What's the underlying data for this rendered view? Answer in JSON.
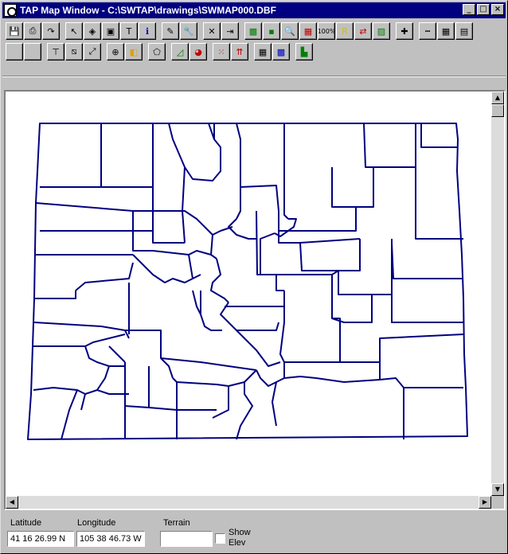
{
  "window": {
    "title": "TAP Map Window - C:\\SWTAP\\drawings\\SWMAP000.DBF",
    "controls": [
      "_",
      "□",
      "×"
    ]
  },
  "toolbar1": {
    "buttons": [
      {
        "name": "save-icon",
        "glyph": "💾"
      },
      {
        "name": "print-icon",
        "glyph": "⎙"
      },
      {
        "name": "redo-arrow-icon",
        "glyph": "↷"
      },
      {
        "name": "pointer-arrow-icon",
        "glyph": "↖"
      },
      {
        "name": "pan-shape-icon",
        "glyph": "◈"
      },
      {
        "name": "stamp-icon",
        "glyph": "▣"
      },
      {
        "name": "text-icon",
        "glyph": "T"
      },
      {
        "name": "info-icon",
        "glyph": "ℹ"
      },
      {
        "name": "measure-icon",
        "glyph": "✎"
      },
      {
        "name": "wrench-icon",
        "glyph": "🔧"
      },
      {
        "name": "delete-x-icon",
        "glyph": "✕"
      },
      {
        "name": "import-icon",
        "glyph": "⇥"
      },
      {
        "name": "zoom-extent-icon",
        "glyph": "▩"
      },
      {
        "name": "zoom-in-small-icon",
        "glyph": "▪"
      },
      {
        "name": "magnify-icon",
        "glyph": "🔍"
      },
      {
        "name": "zoom-box-red-icon",
        "glyph": "▦"
      },
      {
        "name": "zoom-100-icon",
        "glyph": "100%"
      },
      {
        "name": "redraw-r-icon",
        "glyph": "R"
      },
      {
        "name": "refresh-layer-icon",
        "glyph": "⇄"
      },
      {
        "name": "zoom-fit-icon",
        "glyph": "▨"
      },
      {
        "name": "add-point-icon",
        "glyph": "✚"
      },
      {
        "name": "scale-bar-icon",
        "glyph": "┅"
      },
      {
        "name": "grid-icon",
        "glyph": "▦"
      },
      {
        "name": "document-icon",
        "glyph": "▤"
      }
    ]
  },
  "toolbar2": {
    "buttons": [
      {
        "name": "blank-tool-1-icon",
        "glyph": ""
      },
      {
        "name": "blank-tool-2-icon",
        "glyph": ""
      },
      {
        "name": "line-tool-icon",
        "glyph": "⊤"
      },
      {
        "name": "polygon-select-icon",
        "glyph": "⧅"
      },
      {
        "name": "resize-diagonal-icon",
        "glyph": "⤢"
      },
      {
        "name": "move-crosshair-icon",
        "glyph": "⊕"
      },
      {
        "name": "layers-color-icon",
        "glyph": "◧"
      },
      {
        "name": "shape-outline-icon",
        "glyph": "⬠"
      },
      {
        "name": "area-chart-icon",
        "glyph": "◿"
      },
      {
        "name": "pie-chart-icon",
        "glyph": "◕"
      },
      {
        "name": "scatter-points-icon",
        "glyph": "⁙"
      },
      {
        "name": "arrows-up-icon",
        "glyph": "⇈"
      },
      {
        "name": "grid-cells-icon",
        "glyph": "▦"
      },
      {
        "name": "color-grid-icon",
        "glyph": "▩"
      },
      {
        "name": "histogram-icon",
        "glyph": "▙"
      }
    ]
  },
  "map": {
    "boundary_color": "#000080",
    "background": "#ffffff"
  },
  "status": {
    "latitude_label": "Latitude",
    "latitude_value": "41 16 26.99 N",
    "longitude_label": "Longitude",
    "longitude_value": "105 38 46.73 W",
    "terrain_label": "Terrain",
    "terrain_value": "",
    "show_elev_label_1": "Show",
    "show_elev_label_2": "Elev",
    "show_elev_checked": false
  },
  "colors": {
    "titlebar": "#000080",
    "chrome": "#c0c0c0",
    "map_lines": "#000080"
  }
}
